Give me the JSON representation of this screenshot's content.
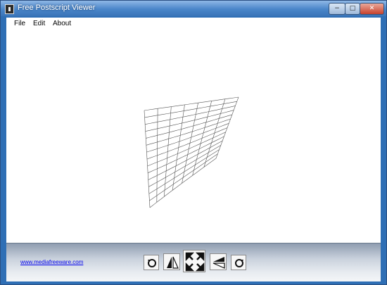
{
  "window": {
    "title": "Free Postscript Viewer"
  },
  "window_controls": {
    "minimize": "−",
    "maximize": "□",
    "close": "✕"
  },
  "menu": {
    "file": "File",
    "edit": "Edit",
    "about": "About"
  },
  "footer": {
    "link": "www.mediafreeware.com"
  },
  "toolbar": {
    "buttons": [
      "rotate-left",
      "flip-horizontal",
      "fit-to-window",
      "flip-vertical",
      "rotate-right"
    ]
  }
}
